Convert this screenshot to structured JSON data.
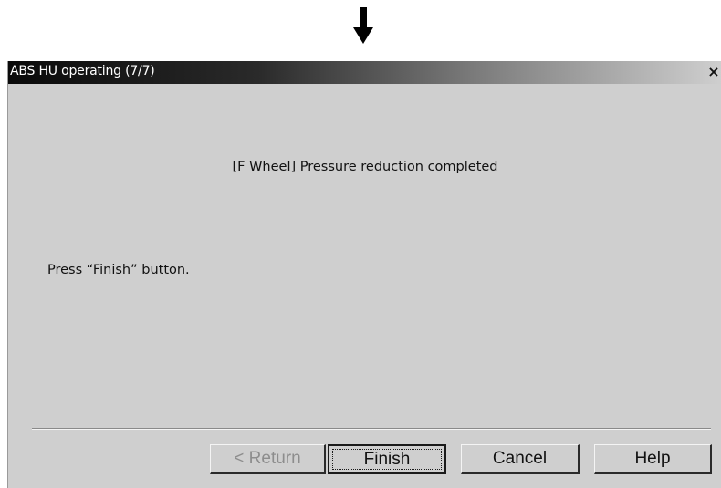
{
  "window": {
    "title": "ABS HU operating (7/7)",
    "close_label": "×"
  },
  "content": {
    "status_message": "[F Wheel] Pressure reduction completed",
    "instruction": "Press “Finish” button."
  },
  "buttons": {
    "return_label": "< Return",
    "finish_label": "Finish",
    "cancel_label": "Cancel",
    "help_label": "Help"
  },
  "icons": {
    "step_arrow": "arrow-down-icon",
    "close": "close-icon"
  }
}
